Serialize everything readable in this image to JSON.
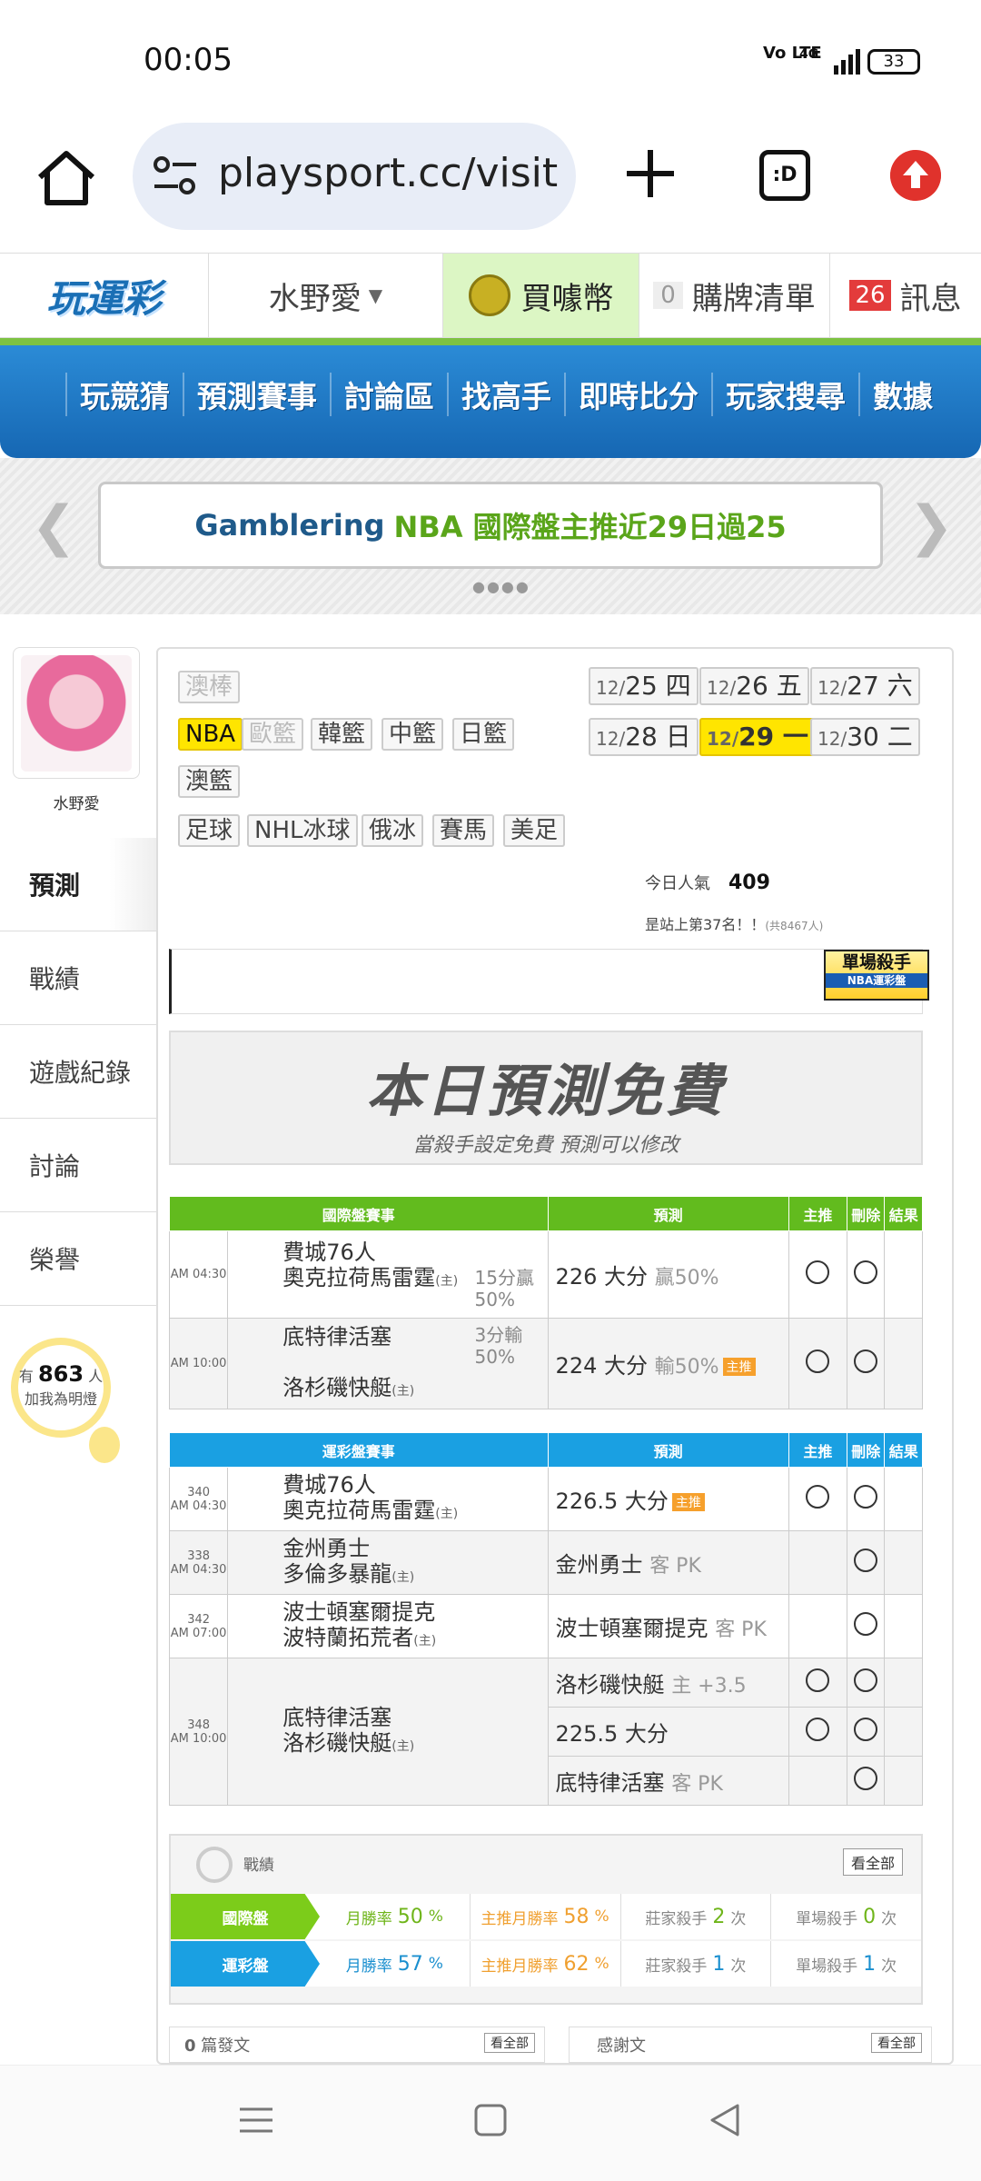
{
  "status": {
    "time": "00:05",
    "network": "4G",
    "volte": "Vo LTE",
    "battery": "33"
  },
  "browser": {
    "url": "playsport.cc/visit",
    "tabs_label": ":D"
  },
  "header": {
    "logo": "玩運彩",
    "user": "水野愛",
    "coins": "買噱幣",
    "cart_count": "0",
    "cart": "購牌清單",
    "msg_count": "26",
    "msgs": "訊息"
  },
  "nav": [
    "玩競猜",
    "預測賽事",
    "討論區",
    "找高手",
    "即時比分",
    "玩家搜尋",
    "數據"
  ],
  "banner": {
    "part1": "Gamblering",
    "part2": "NBA 國際盤主推近29日過25"
  },
  "profile": {
    "name": "水野愛"
  },
  "sidenav": [
    "預測",
    "戰績",
    "遊戲紀錄",
    "討論",
    "榮譽"
  ],
  "fans": {
    "prefix": "有",
    "count": "863",
    "suffix": "人",
    "line2": "加我為明燈"
  },
  "leagues": {
    "row0": [
      "澳棒"
    ],
    "row1": [
      "NBA",
      "歐籃",
      "韓籃",
      "中籃",
      "日籃"
    ],
    "row2": [
      "澳籃"
    ],
    "row3": [
      "足球",
      "NHL冰球",
      "俄冰",
      "賽馬",
      "美足"
    ]
  },
  "dates": [
    {
      "m": "12/",
      "d": "25 四"
    },
    {
      "m": "12/",
      "d": "26 五"
    },
    {
      "m": "12/",
      "d": "27 六"
    },
    {
      "m": "12/",
      "d": "28 日"
    },
    {
      "m": "12/",
      "d": "29 一"
    },
    {
      "m": "12/",
      "d": "30 二"
    }
  ],
  "popularity": {
    "label": "今日人氣",
    "value": "409",
    "rank": "昰站上第37名！！",
    "rank_note": "(共8467人)"
  },
  "killer_badge": {
    "title": "單場殺手",
    "sub": "NBA運彩盤"
  },
  "free": {
    "title": "本日預測免費",
    "sub": "當殺手設定免費  預測可以修改"
  },
  "intl": {
    "headers": [
      "國際盤賽事",
      "預測",
      "主推",
      "刪除",
      "結果"
    ],
    "rows": [
      {
        "time": "AM 04:30",
        "away": "費城76人",
        "home": "奧克拉荷馬雷霆",
        "host": "(主)",
        "line": "15分贏 50%",
        "pred": "226 大分",
        "pred_note": "贏50%"
      },
      {
        "time": "AM 10:00",
        "away": "底特律活塞",
        "home": "洛杉磯快艇",
        "host": "(主)",
        "line": "3分輸 50%",
        "pred": "224 大分",
        "pred_note": "輸50%",
        "hot": "主推"
      }
    ]
  },
  "lottery": {
    "headers": [
      "運彩盤賽事",
      "預測",
      "主推",
      "刪除",
      "結果"
    ],
    "rows": [
      {
        "no": "340",
        "time": "AM 04:30",
        "away": "費城76人",
        "home": "奧克拉荷馬雷霆",
        "host": "(主)",
        "pred": "226.5 大分",
        "hot": "主推"
      },
      {
        "no": "338",
        "time": "AM 04:30",
        "away": "金州勇士",
        "home": "多倫多暴龍",
        "host": "(主)",
        "pred": "金州勇士",
        "pred_note": "客 PK"
      },
      {
        "no": "342",
        "time": "AM 07:00",
        "away": "波士頓塞爾提克",
        "home": "波特蘭拓荒者",
        "host": "(主)",
        "pred": "波士頓塞爾提克",
        "pred_note": "客 PK"
      },
      {
        "no": "348",
        "time": "AM 10:00",
        "away": "底特律活塞",
        "home": "洛杉磯快艇",
        "host": "(主)",
        "preds": [
          {
            "pred": "洛杉磯快艇",
            "pred_note": "主 +3.5"
          },
          {
            "pred": "225.5 大分",
            "pred_note": ""
          },
          {
            "pred": "底特律活塞",
            "pred_note": "客 PK"
          }
        ]
      }
    ]
  },
  "record": {
    "title": "戰績",
    "view_all": "看全部",
    "rows": [
      {
        "label": "國際盤",
        "color": "#7ccc1a",
        "month_rate": "50",
        "main_rate": "58",
        "dealer": "2",
        "single": "0"
      },
      {
        "label": "運彩盤",
        "color": "#1aa0e2",
        "month_rate": "57",
        "main_rate": "62",
        "dealer": "1",
        "single": "1"
      }
    ],
    "month_label": "月勝率",
    "main_label": "主推月勝率",
    "dealer_label": "莊家殺手",
    "single_label": "單場殺手",
    "pct": "%",
    "times": "次"
  },
  "articles": {
    "count": "0",
    "label": "篇發文",
    "view_all": "看全部"
  },
  "thanks": {
    "label": "感謝文",
    "view_all": "看全部"
  }
}
